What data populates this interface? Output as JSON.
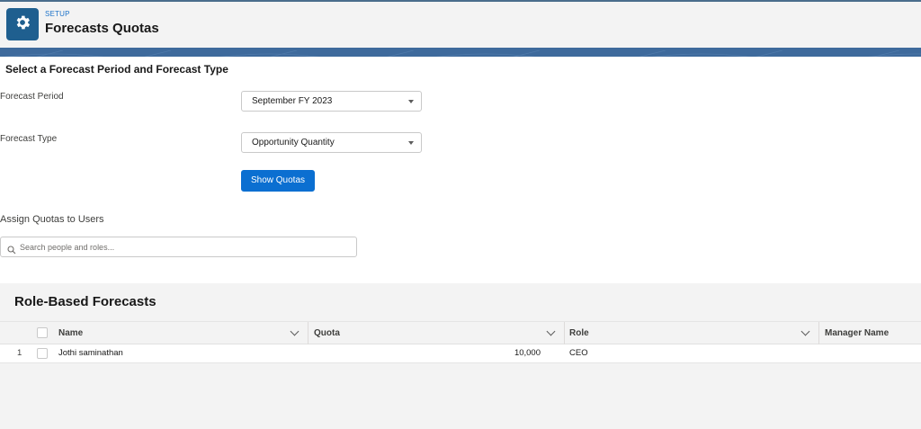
{
  "header": {
    "breadcrumb": "SETUP",
    "title": "Forecasts Quotas",
    "icon": "gear-icon"
  },
  "period_section": {
    "title": "Select a Forecast Period and Forecast Type",
    "forecast_period": {
      "label": "Forecast Period",
      "value": "September FY 2023"
    },
    "forecast_type": {
      "label": "Forecast Type",
      "value": "Opportunity Quantity"
    },
    "show_quotas_label": "Show Quotas"
  },
  "assign_section": {
    "title": "Assign Quotas to Users",
    "search_placeholder": "Search people and roles..."
  },
  "role_based": {
    "title": "Role-Based Forecasts",
    "columns": [
      "Name",
      "Quota",
      "Role",
      "Manager Name"
    ],
    "rows": [
      {
        "index": "1",
        "name": "Jothi saminathan",
        "quota": "10,000",
        "role": "CEO",
        "manager": ""
      }
    ]
  },
  "colors": {
    "brand": "#0b6fd1",
    "header_tile": "#1f5f8f",
    "banner": "#3e6a9c"
  }
}
